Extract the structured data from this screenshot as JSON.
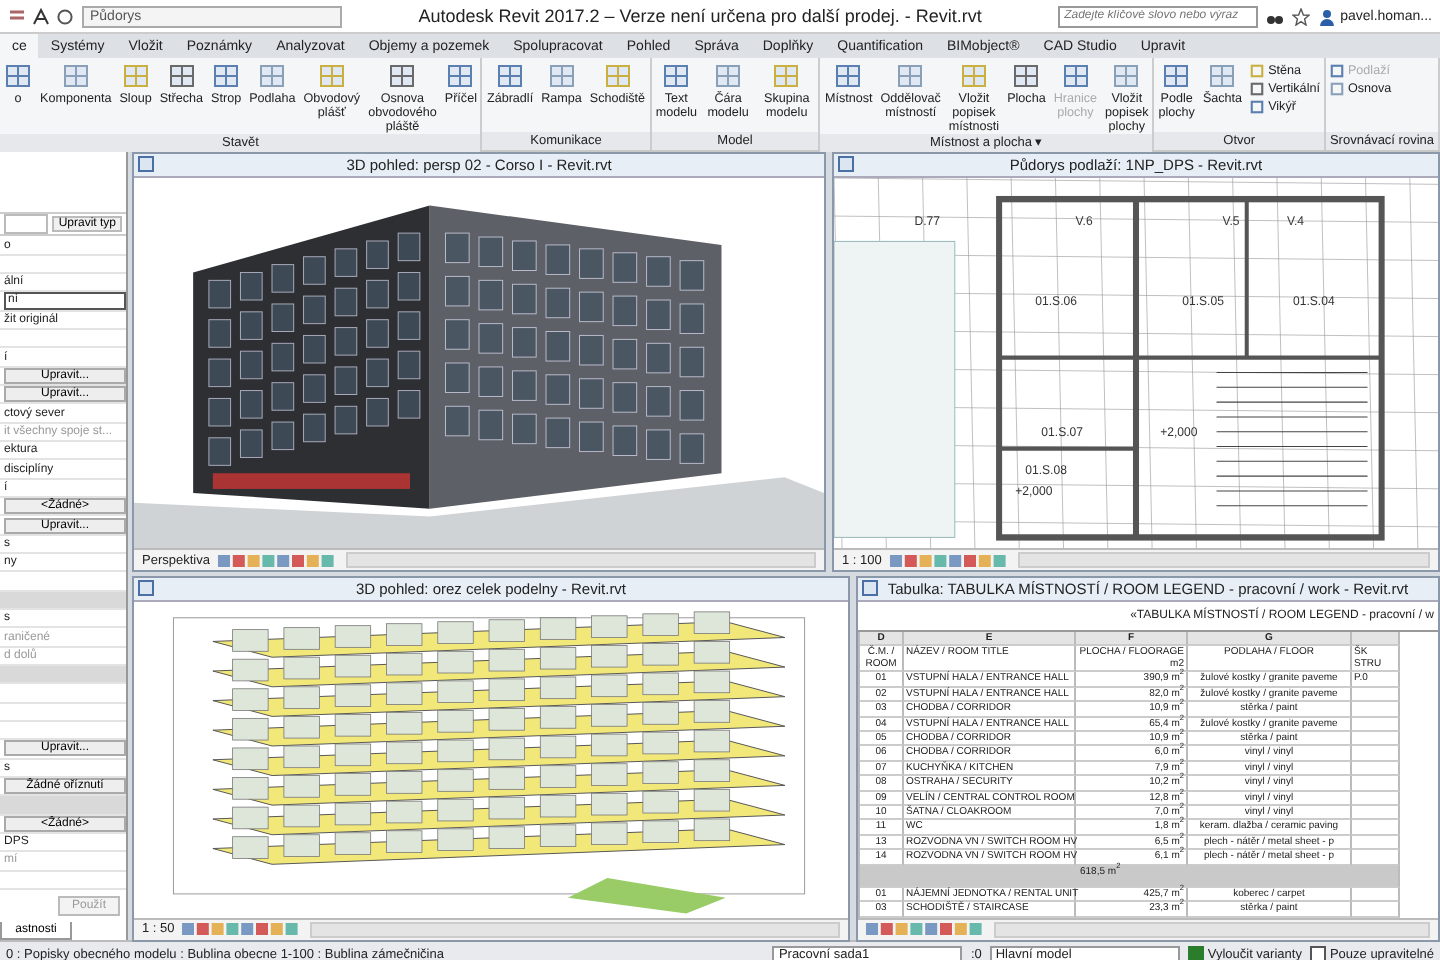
{
  "title_bar": {
    "view_selector": "Půdorys",
    "title": "Autodesk Revit 2017.2 – Verze není určena pro další prodej. -    Revit.rvt",
    "search": {
      "placeholder": "Zadejte klíčové slovo nebo výraz"
    },
    "user": "pavel.homan..."
  },
  "menu_tabs": [
    {
      "label": "ce",
      "selected": true
    },
    {
      "label": "Systémy",
      "selected": false
    },
    {
      "label": "Vložit",
      "selected": false
    },
    {
      "label": "Poznámky",
      "selected": false
    },
    {
      "label": "Analyzovat",
      "selected": false
    },
    {
      "label": "Objemy a pozemek",
      "selected": false
    },
    {
      "label": "Spolupracovat",
      "selected": false
    },
    {
      "label": "Pohled",
      "selected": false
    },
    {
      "label": "Správa",
      "selected": false
    },
    {
      "label": "Doplňky",
      "selected": false
    },
    {
      "label": "Quantification",
      "selected": false
    },
    {
      "label": "BIMobject®",
      "selected": false
    },
    {
      "label": "CAD Studio",
      "selected": false
    },
    {
      "label": "Upravit",
      "selected": false
    }
  ],
  "ribbon_groups": [
    {
      "label": "Stavět",
      "buttons": [
        {
          "kind": "large",
          "label": "o",
          "disabled": false
        },
        {
          "kind": "large",
          "label": "Komponenta",
          "disabled": false
        },
        {
          "kind": "large",
          "label": "Sloup",
          "disabled": false
        },
        {
          "kind": "large",
          "label": "Střecha",
          "disabled": false
        },
        {
          "kind": "large",
          "label": "Strop",
          "disabled": false
        },
        {
          "kind": "large",
          "label": "Podlaha",
          "disabled": false
        },
        {
          "kind": "large",
          "label": "Obvodový plášť",
          "disabled": false
        },
        {
          "kind": "large",
          "label": "Osnova obvodového pláště",
          "disabled": false
        },
        {
          "kind": "large",
          "label": "Příčel",
          "disabled": false
        }
      ]
    },
    {
      "label": "Komunikace",
      "buttons": [
        {
          "kind": "large",
          "label": "Zábradlí",
          "disabled": false
        },
        {
          "kind": "large",
          "label": "Rampa",
          "disabled": false
        },
        {
          "kind": "large",
          "label": "Schodiště",
          "disabled": false
        }
      ]
    },
    {
      "label": "Model",
      "buttons": [
        {
          "kind": "large",
          "label": "Text modelu",
          "disabled": false
        },
        {
          "kind": "large",
          "label": "Čára modelu",
          "disabled": false
        },
        {
          "kind": "large",
          "label": "Skupina modelu",
          "disabled": false
        }
      ]
    },
    {
      "label": "Místnost a plocha ▾",
      "buttons": [
        {
          "kind": "large",
          "label": "Místnost",
          "disabled": false
        },
        {
          "kind": "large",
          "label": "Oddělovač místností",
          "disabled": false
        },
        {
          "kind": "large",
          "label": "Vložit popisek místnosti",
          "disabled": false
        },
        {
          "kind": "large",
          "label": "Plocha",
          "disabled": false
        },
        {
          "kind": "large",
          "label": "Hranice plochy",
          "disabled": true
        },
        {
          "kind": "large",
          "label": "Vložit popisek plochy",
          "disabled": false
        }
      ]
    },
    {
      "label": "Otvor",
      "buttons": [
        {
          "kind": "large",
          "label": "Podle plochy",
          "disabled": false
        },
        {
          "kind": "large",
          "label": "Šachta",
          "disabled": false
        },
        {
          "kind": "small",
          "label": "Stěna",
          "disabled": false
        },
        {
          "kind": "small",
          "label": "Vertikální",
          "disabled": false
        },
        {
          "kind": "small",
          "label": "Vikýř",
          "disabled": false
        }
      ]
    },
    {
      "label": "Srovnávací rovina",
      "buttons": [
        {
          "kind": "small",
          "label": "Podlaží",
          "disabled": true
        },
        {
          "kind": "small",
          "label": "Osnova",
          "disabled": false
        }
      ]
    }
  ],
  "properties": {
    "edit_type": "Upravit typ",
    "rows": [
      {
        "kind": "text",
        "label": "o"
      },
      {
        "kind": "blank"
      },
      {
        "kind": "text",
        "label": "ální"
      },
      {
        "kind": "field",
        "label": "ní"
      },
      {
        "kind": "text",
        "label": "žit originál"
      },
      {
        "kind": "blank"
      },
      {
        "kind": "text",
        "label": "í"
      },
      {
        "kind": "button",
        "label": "Upravit..."
      },
      {
        "kind": "button",
        "label": "Upravit..."
      },
      {
        "kind": "text",
        "label": "ctový sever"
      },
      {
        "kind": "muted",
        "label": "it všechny spoje st..."
      },
      {
        "kind": "text",
        "label": "ektura"
      },
      {
        "kind": "text",
        "label": "disciplíny"
      },
      {
        "kind": "text",
        "label": "í"
      },
      {
        "kind": "button",
        "label": "<Žádné>"
      },
      {
        "kind": "button",
        "label": "Upravit..."
      },
      {
        "kind": "text",
        "label": "s"
      },
      {
        "kind": "text",
        "label": "ny"
      },
      {
        "kind": "blank"
      },
      {
        "kind": "section"
      },
      {
        "kind": "text",
        "label": "s"
      },
      {
        "kind": "muted",
        "label": "raničené"
      },
      {
        "kind": "muted",
        "label": "d dolů"
      },
      {
        "kind": "section"
      },
      {
        "kind": "blank"
      },
      {
        "kind": "blank"
      },
      {
        "kind": "blank"
      },
      {
        "kind": "button",
        "label": "Upravit..."
      },
      {
        "kind": "text",
        "label": "s"
      },
      {
        "kind": "button",
        "label": "Žádné oříznutí"
      },
      {
        "kind": "section"
      },
      {
        "kind": "button",
        "label": "<Žádné>"
      },
      {
        "kind": "text",
        "label": "DPS"
      },
      {
        "kind": "muted",
        "label": "mí"
      },
      {
        "kind": "blank"
      }
    ],
    "apply": "Použít",
    "tab": "astnosti"
  },
  "views": [
    {
      "kind": "perspective",
      "title": "3D pohled: persp 02 - Corso I - Revit.rvt",
      "view_control": "Perspektiva"
    },
    {
      "kind": "plan",
      "title": "Půdorys podlaží: 1NP_DPS - Revit.rvt",
      "view_control": "1 : 100",
      "labels": [
        "D.77",
        "V.6",
        "V.5",
        "V.4",
        "01.S.06",
        "01.S.05",
        "01.S.04",
        "01.S.07",
        "01.S.08",
        "+2,000",
        "+2,000"
      ]
    },
    {
      "kind": "section",
      "title": "3D pohled: orez celek podelny - Revit.rvt",
      "view_control": "1 : 50"
    },
    {
      "kind": "schedule",
      "title": "Tabulka: TABULKA MÍSTNOSTÍ / ROOM LEGEND - pracovní / work - Revit.rvt",
      "heading": "«TABULKA MÍSTNOSTÍ / ROOM LEGEND - pracovní / w",
      "columns": [
        "D",
        "E",
        "F",
        "G"
      ],
      "subheaders": [
        "Č.M. / ROOM",
        "NÁZEV / ROOM TITLE",
        "PLOCHA / FLOORAGE m2",
        "PODLAHA / FLOOR",
        "ŠK STRU"
      ],
      "rows": [
        {
          "kind": "room",
          "cells": [
            "01",
            "VSTUPNÍ HALA / ENTRANCE HALL",
            "390,9 m$^{2}$",
            "žulové kostky / granite paveme",
            "P.0"
          ]
        },
        {
          "kind": "room",
          "cells": [
            "02",
            "VSTUPNÍ HALA / ENTRANCE HALL",
            "82,0 m$^{2}$",
            "žulové kostky / granite paveme",
            ""
          ]
        },
        {
          "kind": "room",
          "cells": [
            "03",
            "CHODBA / CORRIDOR",
            "10,9 m$^{2}$",
            "stěrka / paint",
            ""
          ]
        },
        {
          "kind": "room",
          "cells": [
            "04",
            "VSTUPNÍ HALA / ENTRANCE HALL",
            "65,4 m$^{2}$",
            "žulové kostky / granite paveme",
            ""
          ]
        },
        {
          "kind": "room",
          "cells": [
            "05",
            "CHODBA / CORRIDOR",
            "10,9 m$^{2}$",
            "stěrka / paint",
            ""
          ]
        },
        {
          "kind": "room",
          "cells": [
            "06",
            "CHODBA / CORRIDOR",
            "6,0 m$^{2}$",
            "vinyl / vinyl",
            ""
          ]
        },
        {
          "kind": "room",
          "cells": [
            "07",
            "KUCHYŇKA / KITCHEN",
            "7,9 m$^{2}$",
            "vinyl / vinyl",
            ""
          ]
        },
        {
          "kind": "room",
          "cells": [
            "08",
            "OSTRAHA / SECURITY",
            "10,2 m$^{2}$",
            "vinyl / vinyl",
            ""
          ]
        },
        {
          "kind": "room",
          "cells": [
            "09",
            "VELÍN / CENTRAL CONTROL ROOM",
            "12,8 m$^{2}$",
            "vinyl / vinyl",
            ""
          ]
        },
        {
          "kind": "room",
          "cells": [
            "10",
            "ŠATNA / CLOAKROOM",
            "7,0 m$^{2}$",
            "vinyl / vinyl",
            ""
          ]
        },
        {
          "kind": "room",
          "cells": [
            "11",
            "WC",
            "1,8 m$^{2}$",
            "keram. dlažba / ceramic paving",
            ""
          ]
        },
        {
          "kind": "room",
          "cells": [
            "13",
            "ROZVODNA VN / SWITCH ROOM HV",
            "6,5 m$^{2}$",
            "plech - nátěr / metal sheet - p",
            ""
          ]
        },
        {
          "kind": "room",
          "cells": [
            "14",
            "ROZVODNA VN / SWITCH ROOM HV",
            "6,1 m$^{2}$",
            "plech - nátěr / metal sheet - p",
            ""
          ]
        },
        {
          "kind": "total",
          "cells": [
            "618,5 m$^{2}$"
          ]
        },
        {
          "kind": "room",
          "cells": [
            "01",
            "NÁJEMNÍ JEDNOTKA / RENTAL UNIT",
            "425,7 m$^{2}$",
            "koberec / carpet",
            ""
          ]
        },
        {
          "kind": "room",
          "cells": [
            "03",
            "SCHODIŠTĚ / STAIRCASE",
            "23,3 m$^{2}$",
            "stěrka / paint",
            ""
          ]
        }
      ]
    }
  ],
  "status_bar": {
    "message": "0 : Popisky obecného modelu : Bublina obecne 1-100 : Bublina zámečničina",
    "workset": "Pracovní sada1",
    "count": ":0",
    "design_option": "Hlavní model",
    "exclude_options": {
      "label": "Vyloučit varianty",
      "checked": true
    },
    "editable_only": {
      "label": "Pouze upravitelné",
      "checked": false
    }
  }
}
